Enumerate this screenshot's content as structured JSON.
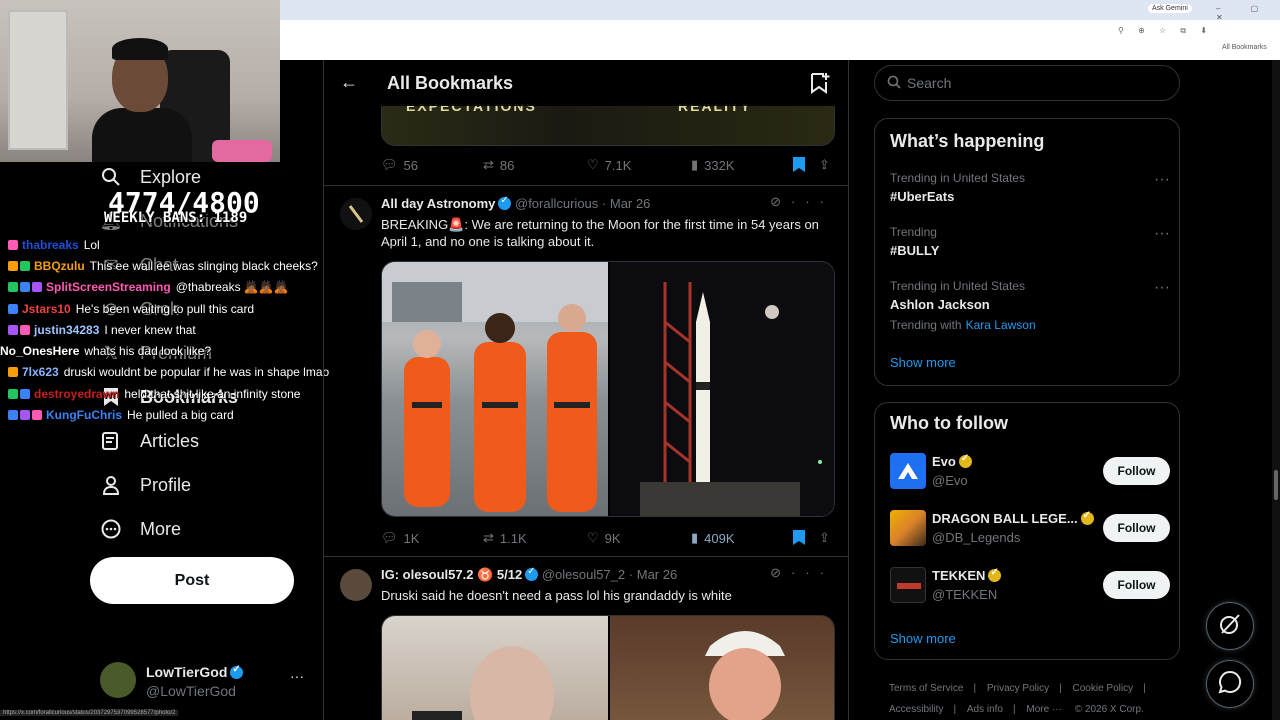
{
  "browser": {
    "ask_gemini": "Ask Gemini",
    "all_bookmarks_chip": "All Bookmarks"
  },
  "stream": {
    "counter": "4774/4800",
    "weekly": "WEEKLY BANS: 1189"
  },
  "nav": {
    "items": [
      {
        "label": "Explore",
        "icon": "search-icon"
      },
      {
        "label": "Notifications",
        "icon": "bell-icon"
      },
      {
        "label": "Chat",
        "icon": "mail-icon"
      },
      {
        "label": "Grok",
        "icon": "grok-icon"
      },
      {
        "label": "Premium",
        "icon": "x-logo-icon"
      },
      {
        "label": "Bookmarks",
        "icon": "bookmark-icon"
      },
      {
        "label": "Articles",
        "icon": "article-icon"
      },
      {
        "label": "Profile",
        "icon": "person-icon"
      },
      {
        "label": "More",
        "icon": "more-circle-icon"
      }
    ],
    "post_label": "Post"
  },
  "current_user": {
    "name": "LowTierGod",
    "handle": "@LowTierGod"
  },
  "chat": [
    {
      "user": "thabreaks",
      "msg": "Lol",
      "color": "#1d4ed8"
    },
    {
      "user": "BBQzulu",
      "msg": "This ee wall ee was slinging black cheeks?",
      "color": "#f59e0b"
    },
    {
      "user": "SplitScreenStreaming",
      "msg": "@thabreaks 🙇🏾🙇🏾🙇🏾",
      "color": "#ff5ab4"
    },
    {
      "user": "Jstars10",
      "msg": "He's been waiting to pull this card",
      "color": "#ef4444"
    },
    {
      "user": "justin34283",
      "msg": "I never knew that",
      "color": "#9ec5ff"
    },
    {
      "user": "No_OnesHere",
      "msg": "whats his dad look like?",
      "color": "#ffffff"
    },
    {
      "user": "7lx623",
      "msg": "druski wouldnt be popular if he was in shape lmao",
      "color": "#8ab4ff"
    },
    {
      "user": "destroyedrawn",
      "msg": "held that shit like an infinity stone",
      "color": "#c81e1e"
    },
    {
      "user": "KungFuChris",
      "msg": "He pulled a big card",
      "color": "#3b82f6"
    }
  ],
  "status_url": "https://x.com/forallcurious/status/2037297537099528577/photo/2",
  "feed": {
    "title": "All Bookmarks",
    "top_media_text_left": "EXPECTATIONS",
    "top_media_text_right": "REALITY",
    "top_actions": {
      "replies": "56",
      "reposts": "86",
      "likes": "7.1K",
      "views": "332K"
    },
    "tweets": [
      {
        "name": "All day Astronomy",
        "handle": "@forallcurious",
        "date": "Mar 26",
        "text": "BREAKING🚨: We are returning to the Moon for the first time in 54 years on April 1, and no one is talking about it.",
        "replies": "1K",
        "reposts": "1.1K",
        "likes": "9K",
        "views": "409K"
      },
      {
        "name": "IG: olesoul57.2 ♉ 5/12",
        "handle": "@olesoul57_2",
        "date": "Mar 26",
        "text": "Druski said he doesn't need a pass lol his grandaddy is white"
      }
    ]
  },
  "sidebar_right": {
    "search_placeholder": "Search",
    "happening_title": "What’s happening",
    "trends": [
      {
        "context": "Trending in United States",
        "topic": "#UberEats"
      },
      {
        "context": "Trending",
        "topic": "#BULLY"
      },
      {
        "context": "Trending in United States",
        "topic": "Ashlon Jackson",
        "with_label": "Trending with",
        "with_link": "Kara Lawson"
      }
    ],
    "show_more": "Show more",
    "who_title": "Who to follow",
    "follow": [
      {
        "name": "Evo",
        "handle": "@Evo",
        "color": "#1e6ff2"
      },
      {
        "name": "DRAGON BALL LEGE...",
        "handle": "@DB_Legends",
        "color": "#d9822b"
      },
      {
        "name": "TEKKEN",
        "handle": "@TEKKEN",
        "color": "#111111"
      }
    ],
    "follow_label": "Follow",
    "show_more2": "Show more",
    "footer": {
      "terms": "Terms of Service",
      "privacy": "Privacy Policy",
      "cookie": "Cookie Policy",
      "access": "Accessibility",
      "ads": "Ads info",
      "more": "More ···",
      "copy": "© 2026 X Corp."
    }
  },
  "colors": {
    "accent": "#1d9bf0",
    "bg": "#000000",
    "border": "#2f3336"
  }
}
